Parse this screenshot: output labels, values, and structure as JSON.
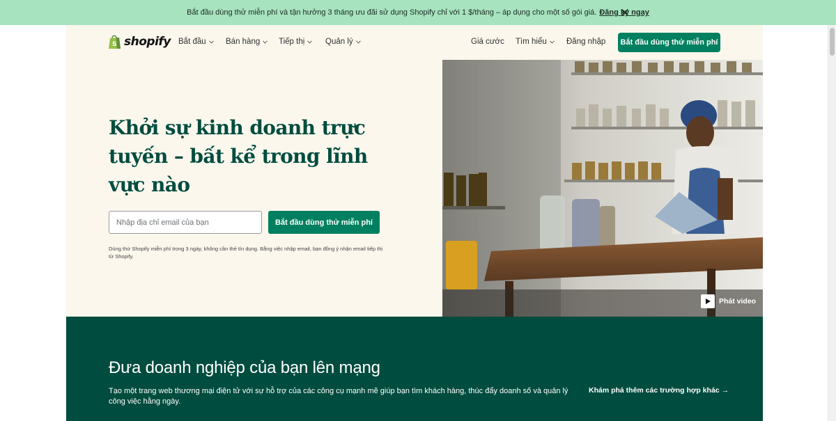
{
  "banner": {
    "text": "Bắt đầu dùng thử miễn phí và tận hưởng 3 tháng ưu đãi sử dụng Shopify chỉ với 1 $/tháng – áp dụng cho một số gói giá.",
    "link": "Đăng ký ngay"
  },
  "header": {
    "logo_text": "shopify",
    "nav_left": [
      "Bắt đầu",
      "Bán hàng",
      "Tiếp thị",
      "Quản lý"
    ],
    "pricing": "Giá cước",
    "learn": "Tìm hiểu",
    "login": "Đăng nhập",
    "cta": "Bắt đầu dùng thử miễn phí"
  },
  "hero": {
    "title": "Khởi sự kinh doanh trực tuyến – bất kể trong lĩnh vực nào",
    "email_placeholder": "Nhập địa chỉ email của bạn",
    "cta": "Bắt đầu dùng thử miễn phí",
    "disclaimer": "Dùng thử Shopify miễn phí trong 3 ngày, không cần thẻ tín dụng. Bằng việc nhập email, bạn đồng ý nhận email tiếp thị từ Shopify.",
    "play_label": "Phát video"
  },
  "section": {
    "title": "Đưa doanh nghiệp của bạn lên mạng",
    "description": "Tạo một trang web thương mại điện tử với sự hỗ trợ của các công cụ mạnh mẽ giúp bạn tìm khách hàng, thúc đẩy doanh số và quản lý công việc hằng ngày.",
    "explore": "Khám phá thêm các trường hợp khác →"
  },
  "colors": {
    "banner": "#a6e3be",
    "brand_green": "#008060",
    "dark_green": "#004c3f",
    "hero_bg": "#fbf7ed"
  },
  "icons": [
    "shopify-bag-icon",
    "chevron-down-icon",
    "close-icon",
    "play-icon"
  ]
}
